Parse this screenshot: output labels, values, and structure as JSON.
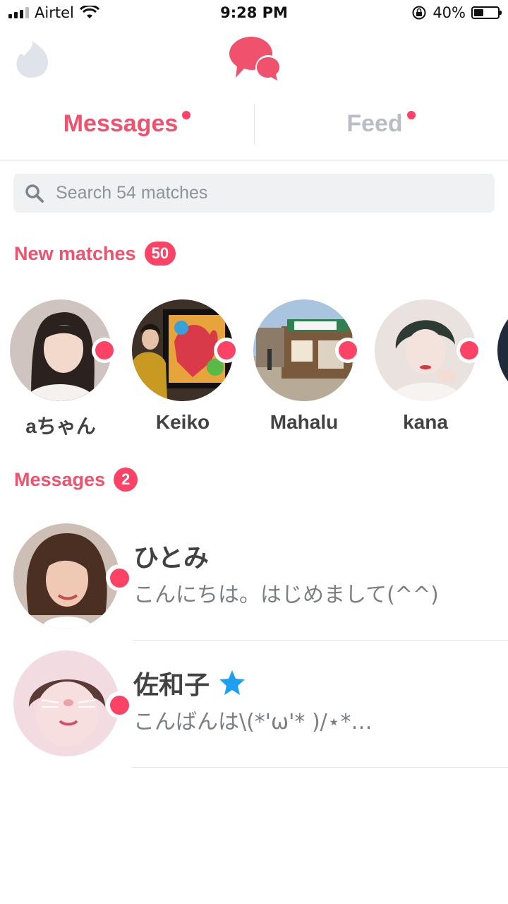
{
  "status_bar": {
    "carrier": "Airtel",
    "time": "9:28 PM",
    "battery": "40%",
    "battery_level": 0.4
  },
  "tabs": {
    "messages": "Messages",
    "feed": "Feed"
  },
  "search": {
    "placeholder": "Search 54 matches"
  },
  "new_matches": {
    "title": "New matches",
    "count": "50",
    "items": [
      {
        "name": "aちゃん"
      },
      {
        "name": "Keiko"
      },
      {
        "name": "Mahalu"
      },
      {
        "name": "kana"
      }
    ]
  },
  "messages": {
    "title": "Messages",
    "count": "2",
    "items": [
      {
        "name": "ひとみ",
        "preview": "こんにちは。はじめまして(^^)",
        "starred": false
      },
      {
        "name": "佐和子",
        "preview": "こんばんは\\(*'ω'* )/⋆*…",
        "starred": true
      }
    ]
  },
  "colors": {
    "accent": "#fd4365",
    "accent_text": "#f0516d",
    "inactive": "#b9bec5",
    "star": "#1ea0f0"
  }
}
